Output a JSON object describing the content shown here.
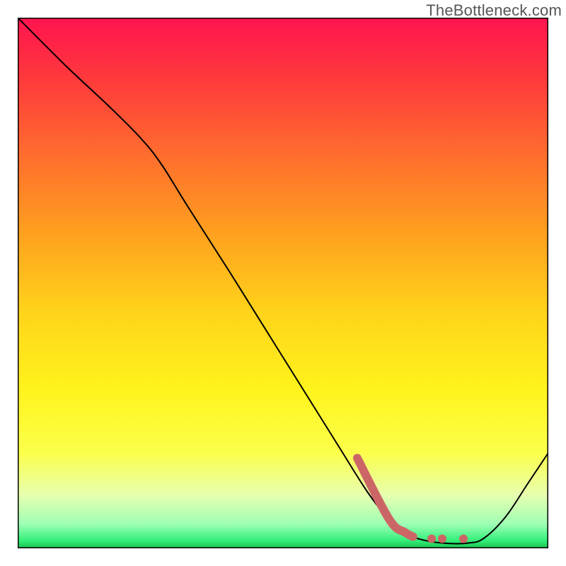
{
  "watermark": "TheBottleneck.com",
  "chart_data": {
    "type": "line",
    "title": "",
    "xlabel": "",
    "ylabel": "",
    "xlim": [
      0,
      1
    ],
    "ylim": [
      0,
      1
    ],
    "grid": false,
    "legend": false,
    "gradient_stops": [
      {
        "pos": 0.0,
        "color": "#ff134f"
      },
      {
        "pos": 0.12,
        "color": "#ff3b3b"
      },
      {
        "pos": 0.25,
        "color": "#ff6a2f"
      },
      {
        "pos": 0.4,
        "color": "#ff9e1f"
      },
      {
        "pos": 0.55,
        "color": "#ffd21a"
      },
      {
        "pos": 0.7,
        "color": "#fff31c"
      },
      {
        "pos": 0.82,
        "color": "#fbff4a"
      },
      {
        "pos": 0.9,
        "color": "#e7ffb0"
      },
      {
        "pos": 0.955,
        "color": "#9dffb4"
      },
      {
        "pos": 0.985,
        "color": "#34f07a"
      },
      {
        "pos": 1.0,
        "color": "#17c24f"
      }
    ],
    "series": [
      {
        "name": "bottleneck-curve",
        "color": "#000000",
        "stroke_width": 2,
        "points": [
          {
            "x": 0.0,
            "y": 1.0
          },
          {
            "x": 0.09,
            "y": 0.91
          },
          {
            "x": 0.17,
            "y": 0.835
          },
          {
            "x": 0.23,
            "y": 0.775
          },
          {
            "x": 0.27,
            "y": 0.725
          },
          {
            "x": 0.32,
            "y": 0.645
          },
          {
            "x": 0.4,
            "y": 0.52
          },
          {
            "x": 0.5,
            "y": 0.36
          },
          {
            "x": 0.6,
            "y": 0.2
          },
          {
            "x": 0.66,
            "y": 0.105
          },
          {
            "x": 0.7,
            "y": 0.055
          },
          {
            "x": 0.73,
            "y": 0.03
          },
          {
            "x": 0.755,
            "y": 0.018
          },
          {
            "x": 0.8,
            "y": 0.01
          },
          {
            "x": 0.85,
            "y": 0.01
          },
          {
            "x": 0.88,
            "y": 0.02
          },
          {
            "x": 0.92,
            "y": 0.06
          },
          {
            "x": 0.96,
            "y": 0.12
          },
          {
            "x": 1.0,
            "y": 0.18
          }
        ]
      },
      {
        "name": "highlight-segment",
        "color": "#cc6666",
        "stroke_width": 12,
        "points": [
          {
            "x": 0.64,
            "y": 0.17
          },
          {
            "x": 0.7,
            "y": 0.055
          },
          {
            "x": 0.73,
            "y": 0.03
          },
          {
            "x": 0.745,
            "y": 0.022
          }
        ]
      }
    ],
    "highlight_dots": {
      "color": "#cc6666",
      "r": 6,
      "points": [
        {
          "x": 0.78,
          "y": 0.018
        },
        {
          "x": 0.8,
          "y": 0.018
        },
        {
          "x": 0.84,
          "y": 0.018
        }
      ]
    }
  }
}
